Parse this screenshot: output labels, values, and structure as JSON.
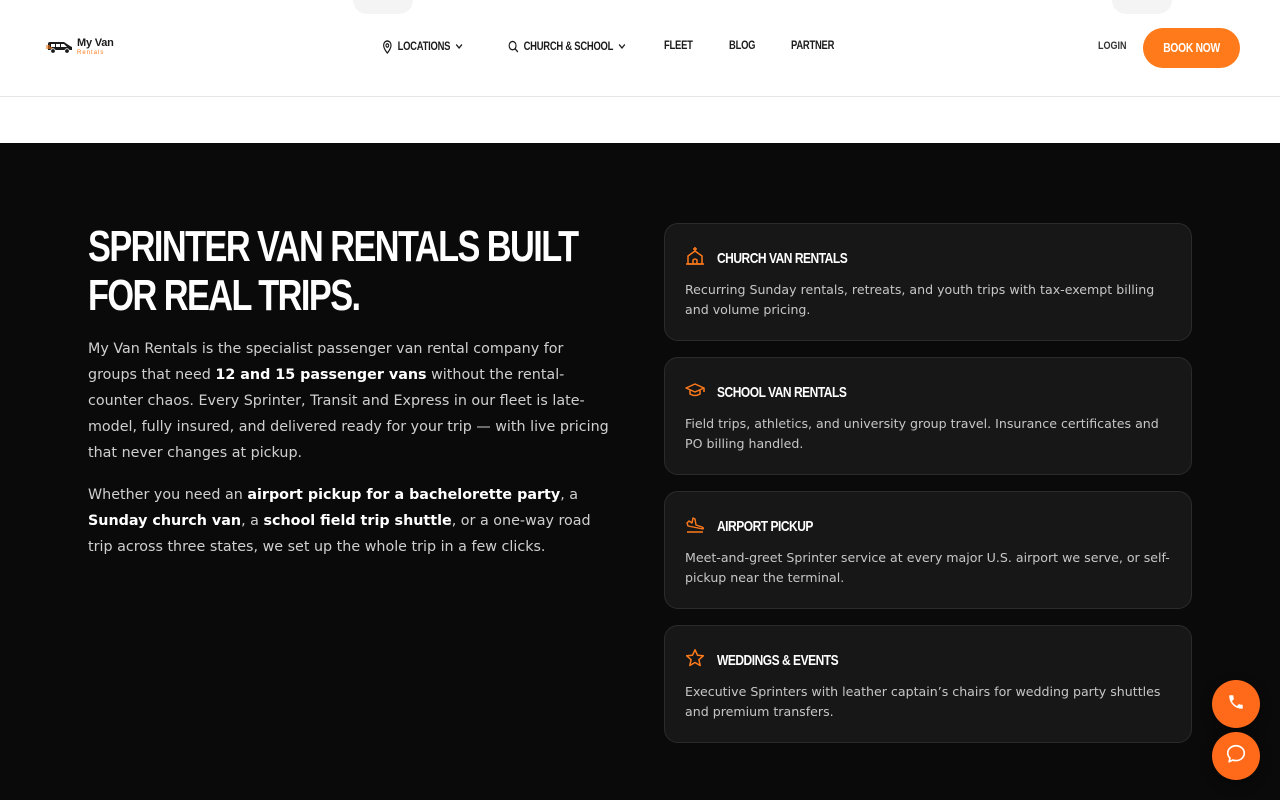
{
  "brand": {
    "logo_main": "My Van",
    "logo_sub": "Rentals"
  },
  "nav": {
    "items": [
      {
        "label": "Locations",
        "icon": "map-pin-icon",
        "dropdown": true
      },
      {
        "label": "Church & School",
        "icon": "search-icon",
        "dropdown": true
      },
      {
        "label": "Fleet"
      },
      {
        "label": "Blog"
      },
      {
        "label": "Partner"
      }
    ],
    "login_label": "Login",
    "book_label": "Book Now"
  },
  "hero": {
    "title": "Sprinter van rentals built for real trips.",
    "para1": {
      "t1": "My Van Rentals is the specialist passenger van rental company for groups that need ",
      "b1": "12 and 15 passenger vans",
      "t2": " without the rental-counter chaos. Every Sprinter, Transit and Express in our fleet is late-model, fully insured, and delivered ready for your trip — with live pricing that never changes at pickup."
    },
    "para2": {
      "t1": "Whether you need an ",
      "b1": "airport pickup for a bachelorette party",
      "t2": ", a ",
      "b2": "Sunday church van",
      "t3": ", a ",
      "b3": "school field trip shuttle",
      "t4": ", or a one-way road trip across three states, we set up the whole trip in a few clicks."
    }
  },
  "cards": [
    {
      "icon": "church-icon",
      "title": "Church van rentals",
      "desc": "Recurring Sunday rentals, retreats, and youth trips with tax-exempt billing and volume pricing."
    },
    {
      "icon": "graduation-cap-icon",
      "title": "School van rentals",
      "desc": "Field trips, athletics, and university group travel. Insurance certificates and PO billing handled."
    },
    {
      "icon": "plane-landing-icon",
      "title": "Airport pickup",
      "desc": "Meet-and-greet Sprinter service at every major U.S. airport we serve, or self-pickup near the terminal."
    },
    {
      "icon": "star-icon",
      "title": "Weddings & Events",
      "desc": "Executive Sprinters with leather captain’s chairs for wedding party shuttles and premium transfers."
    }
  ],
  "floating": {
    "phone_icon": "phone-icon",
    "chat_icon": "chat-bubble-icon"
  },
  "colors": {
    "accent": "#ff7a1a",
    "dark_bg": "#0a0a0b",
    "card_bg": "#171718"
  }
}
